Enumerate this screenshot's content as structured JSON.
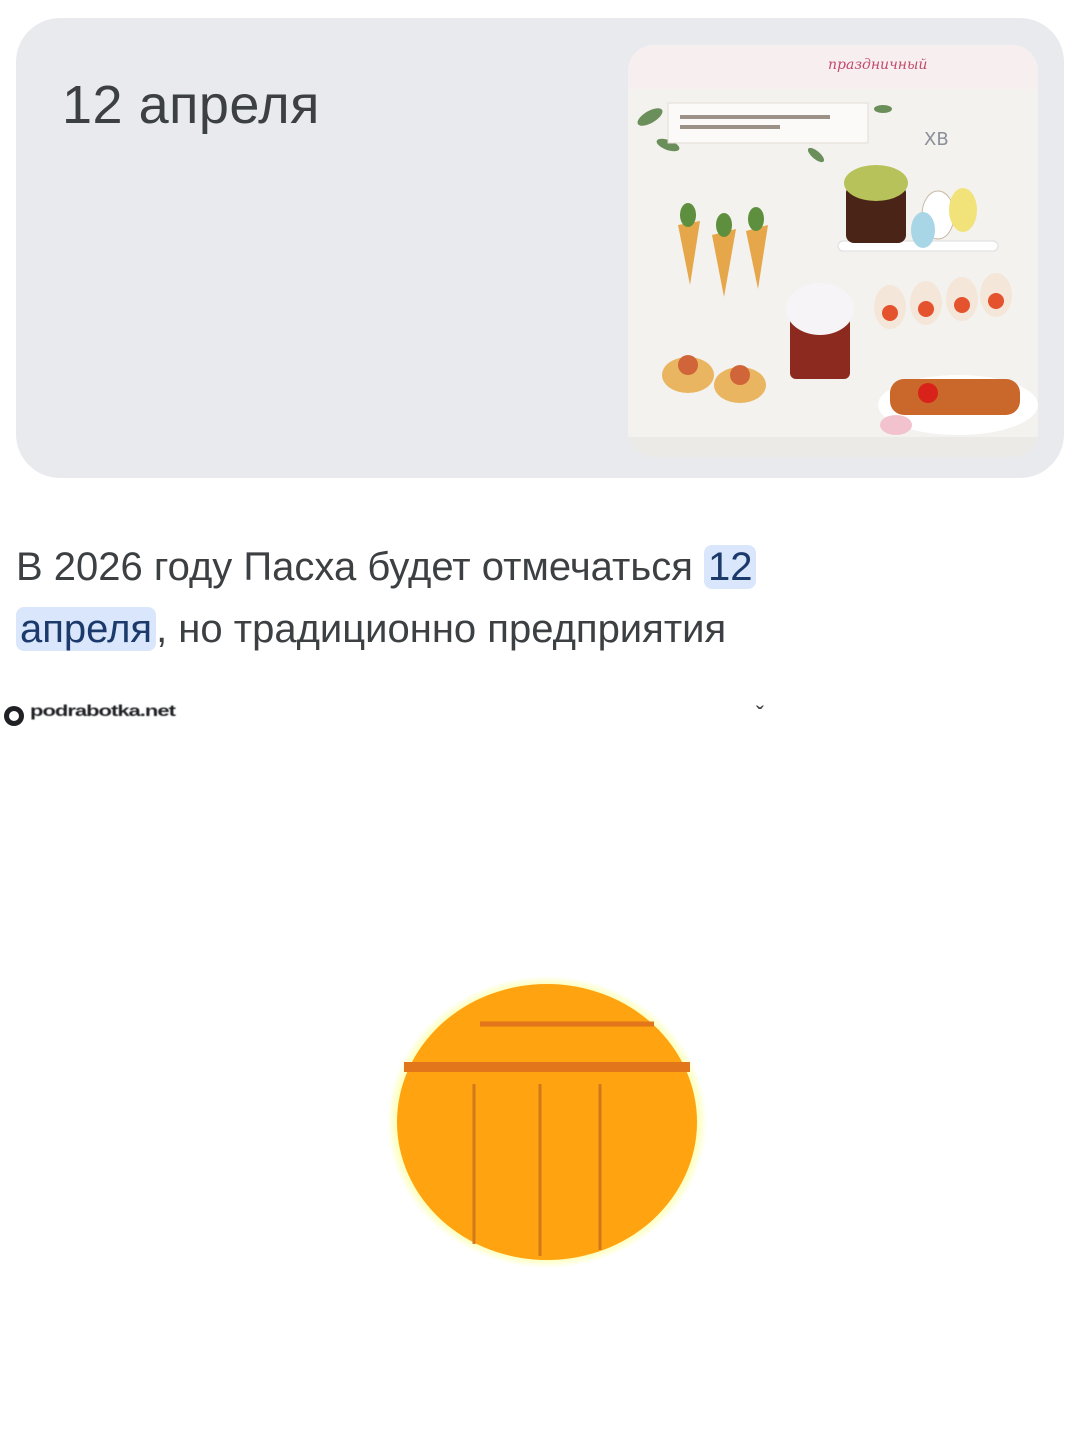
{
  "answer_card": {
    "title": "12 апреля",
    "thumbnail": {
      "description_icon": "easter-table-photo",
      "caption_text": "праздничный"
    }
  },
  "snippet": {
    "text_before": "В 2026 году Пасха будет отмечаться ",
    "highlight_line1": "12",
    "highlight_line2": "апреля",
    "text_after": ", но традиционно предприятия"
  },
  "source": {
    "icon": "site-logo-icon",
    "name": "podrabotka.net",
    "expand_icon": "chevron-down-icon"
  },
  "loader": {
    "icon": "orange-loading-circle-icon",
    "colors": {
      "fill": "#ff9e0a",
      "glow": "#f5ff1a"
    }
  },
  "colors": {
    "card_bg": "#e8eaed",
    "highlight_bg": "#d9e6fb",
    "text": "#3c4043"
  }
}
